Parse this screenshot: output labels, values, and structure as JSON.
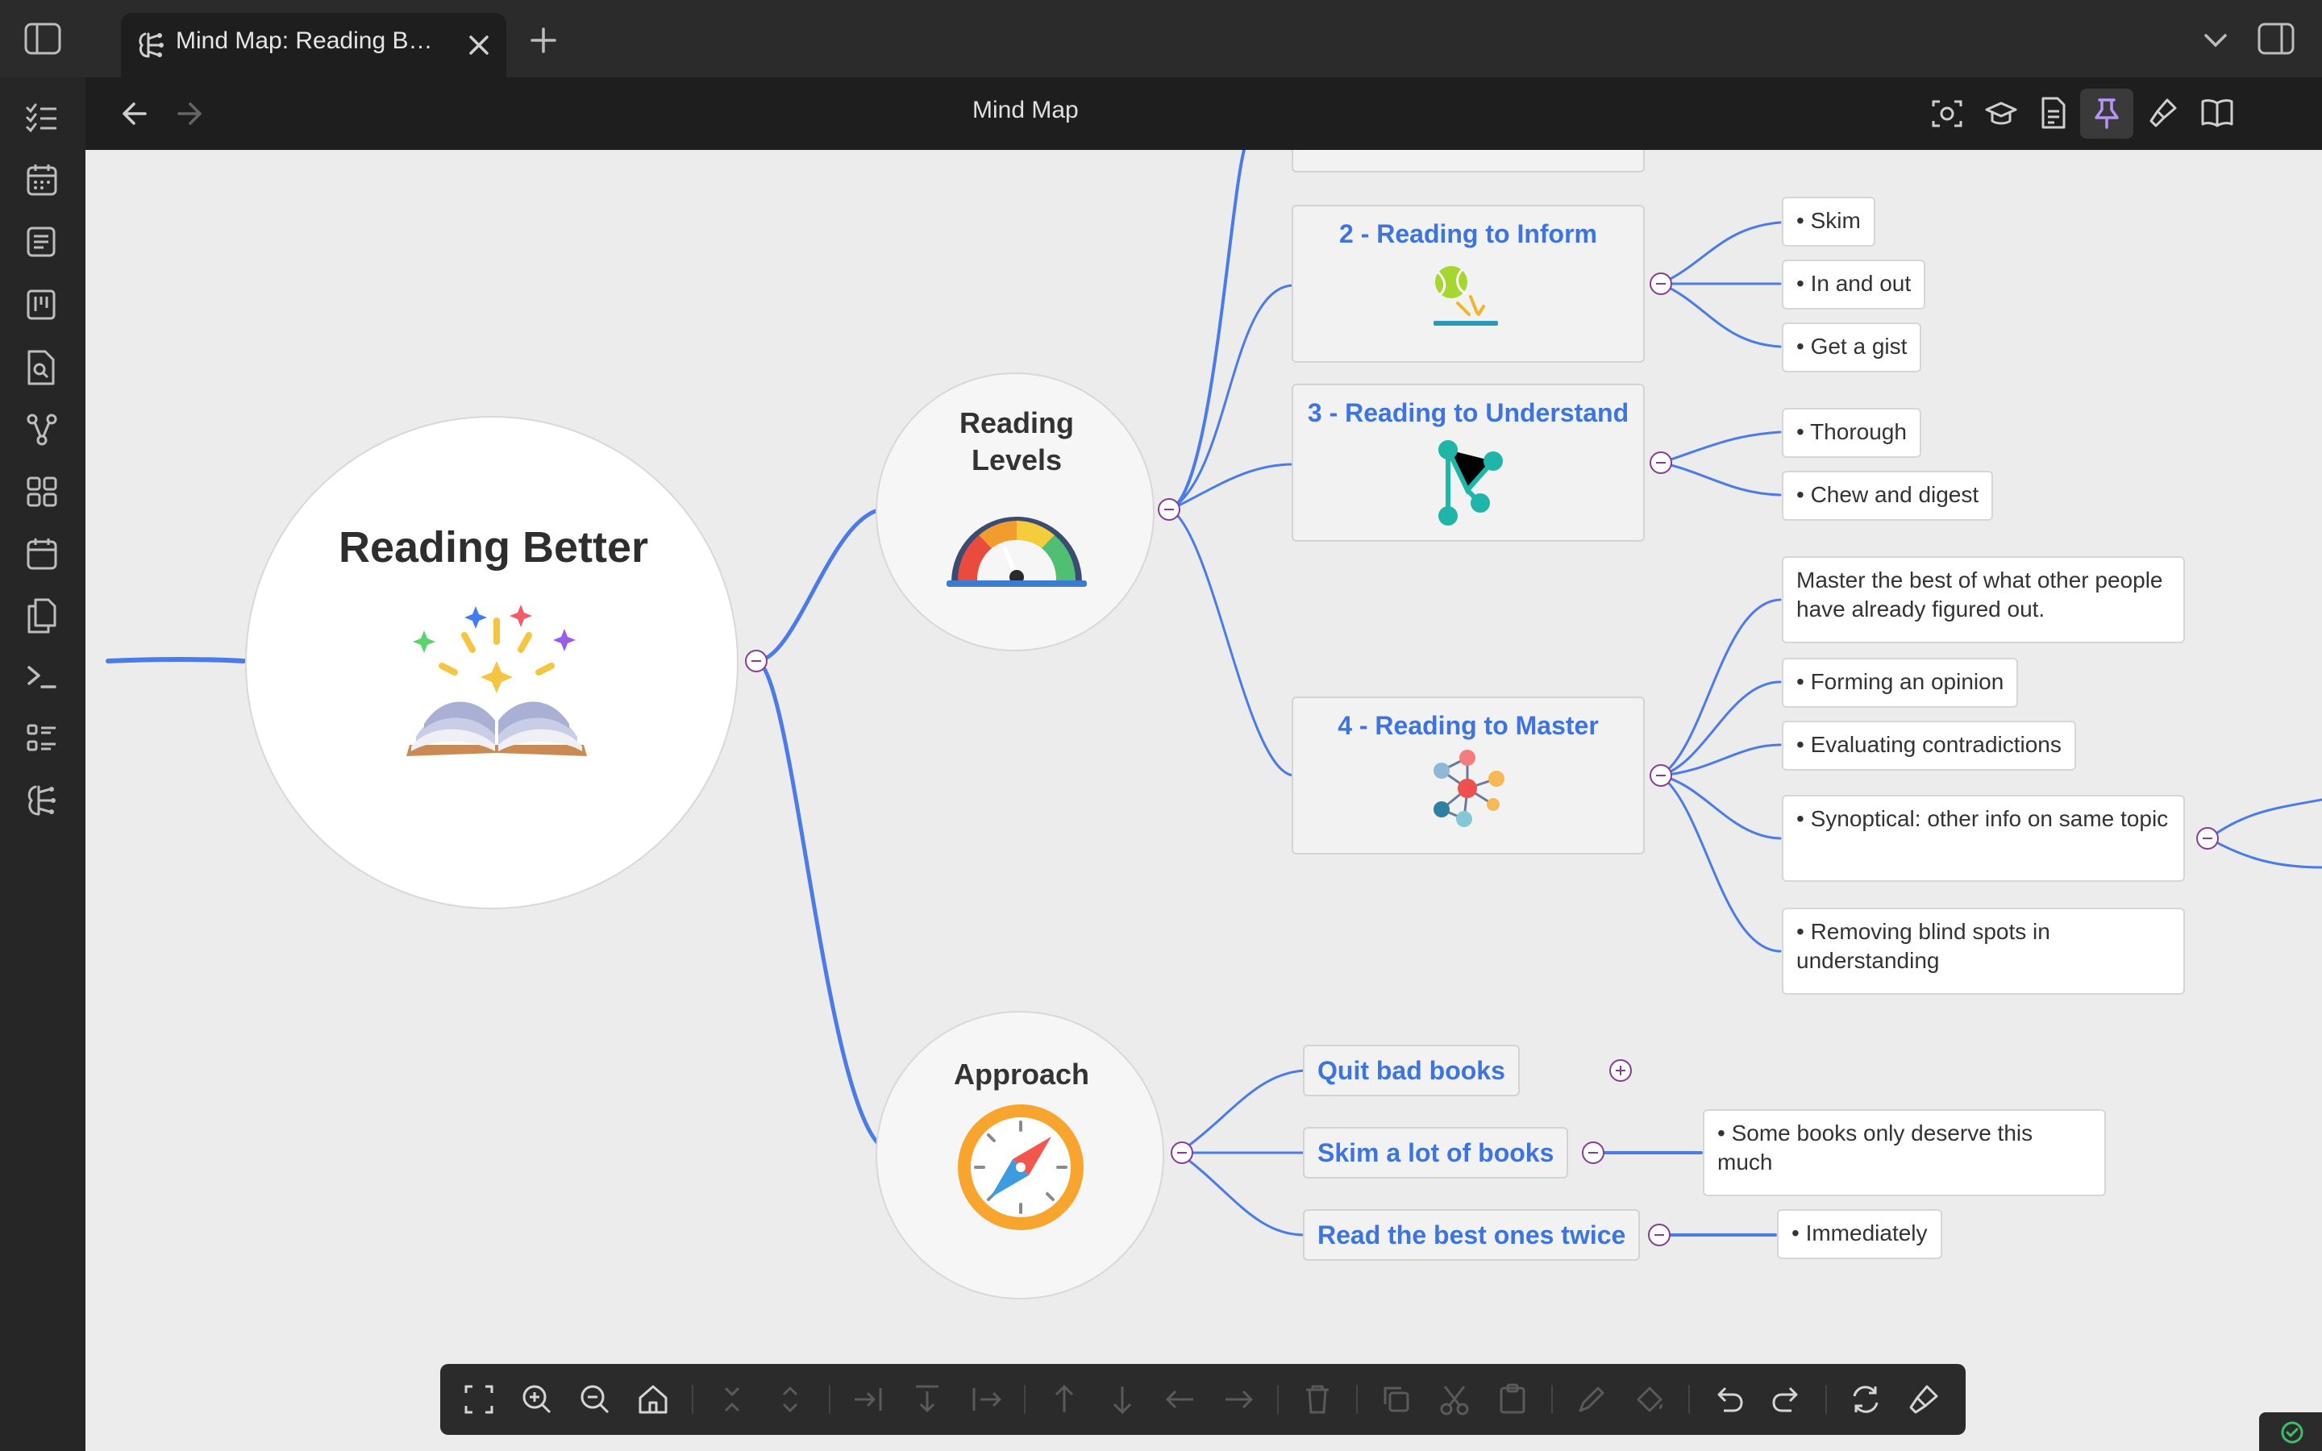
{
  "tab": {
    "title": "Mind Map: Reading B…"
  },
  "view": {
    "title": "Mind Map"
  },
  "root": {
    "label": "Reading Better"
  },
  "levels": {
    "label_line1": "Reading",
    "label_line2": "Levels",
    "items": [
      {
        "label": "2 - Reading to Inform",
        "leaves": [
          "• Skim",
          "• In and out",
          "• Get a gist"
        ]
      },
      {
        "label": "3 - Reading to Understand",
        "leaves": [
          "• Thorough",
          "• Chew and digest"
        ]
      },
      {
        "label": "4 - Reading to Master",
        "leaves": [
          "Master the best of what other people have already figured out.",
          "• Forming an opinion",
          "• Evaluating contradictions",
          "• Synoptical: other info on same topic",
          "• Removing blind spots in understanding"
        ]
      }
    ]
  },
  "approach": {
    "label": "Approach",
    "items": [
      {
        "label": "Quit bad books"
      },
      {
        "label": "Skim a lot of books",
        "leaf": "• Some books only deserve this much"
      },
      {
        "label": "Read the best ones twice",
        "leaf": "• Immediately"
      }
    ]
  },
  "colors": {
    "accent": "#4a7be8",
    "link_text": "#3d74e0",
    "toggle": "#8a3b95",
    "active_pin": "#b794f6"
  },
  "icons": {
    "ribbon": [
      "sidebar-toggle-icon",
      "tasks-icon",
      "calendar-icon",
      "note-icon",
      "kanban-icon",
      "file-search-icon",
      "graph-icon",
      "dashboard-icon",
      "daily-note-icon",
      "documents-icon",
      "terminal-icon",
      "list-icon",
      "mindmap-icon"
    ],
    "toolbar": [
      "fit-screen-icon",
      "zoom-in-icon",
      "zoom-out-icon",
      "home-icon",
      "collapse-icon",
      "expand-icon",
      "indent-icon",
      "move-down-icon",
      "outdent-icon",
      "arrow-up-icon",
      "arrow-down-icon",
      "arrow-left-icon",
      "arrow-right-icon",
      "delete-icon",
      "copy-icon",
      "cut-icon",
      "paste-icon",
      "pen-icon",
      "fill-icon",
      "undo-icon",
      "redo-icon",
      "refresh-icon",
      "brush-icon"
    ]
  }
}
